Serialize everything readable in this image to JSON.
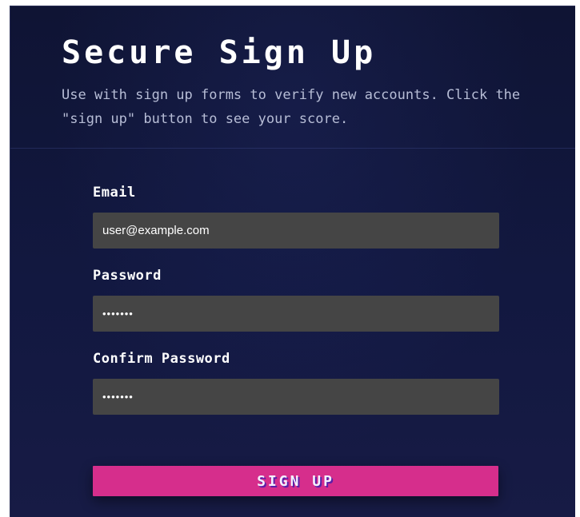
{
  "header": {
    "title": "Secure Sign Up",
    "subtitle": "Use with sign up forms to verify new accounts. Click the \"sign up\" button to see your score."
  },
  "form": {
    "email": {
      "label": "Email",
      "value": "user@example.com"
    },
    "password": {
      "label": "Password",
      "value": "•••••••"
    },
    "confirm_password": {
      "label": "Confirm Password",
      "value": "•••••••"
    },
    "submit_label": "SIGN UP"
  },
  "colors": {
    "background": "#111638",
    "input_bg": "#454545",
    "button_bg": "#d62e8c",
    "button_text_shadow": "#5a1fa8"
  }
}
